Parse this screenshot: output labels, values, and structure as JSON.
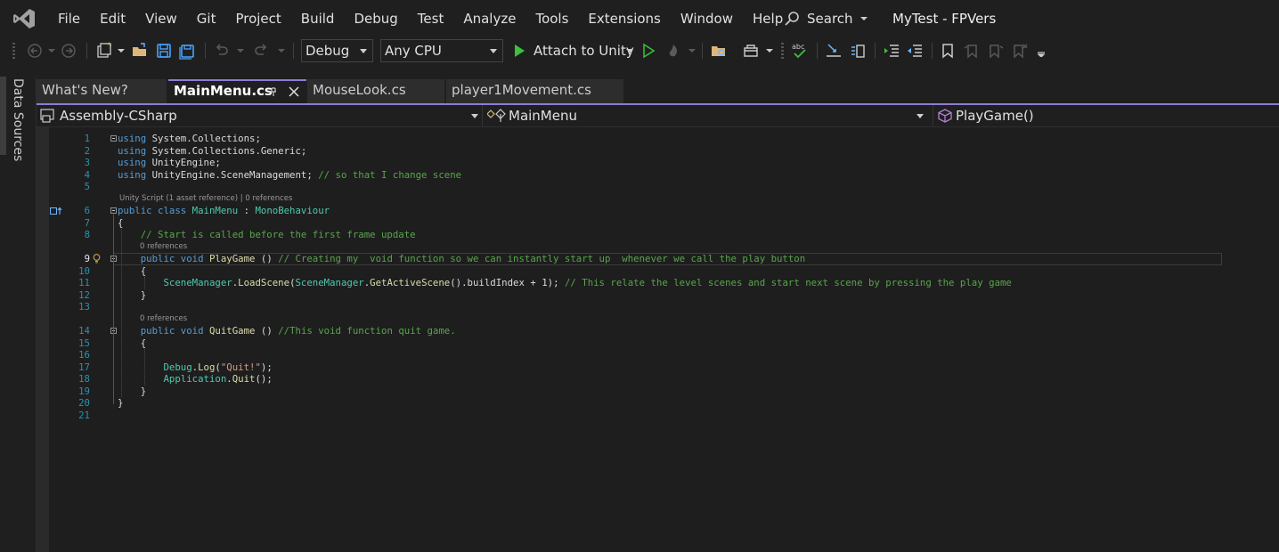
{
  "menu": [
    "File",
    "Edit",
    "View",
    "Git",
    "Project",
    "Build",
    "Debug",
    "Test",
    "Analyze",
    "Tools",
    "Extensions",
    "Window",
    "Help"
  ],
  "search_label": "Search",
  "solution_name": "MyTest - FPVers",
  "toolbar": {
    "config": "Debug",
    "platform": "Any CPU",
    "attach_label": "Attach to Unity",
    "icons": [
      "back-icon",
      "forward-icon",
      "new-item-icon",
      "open-folder-icon",
      "save-icon",
      "save-all-icon",
      "undo-icon",
      "redo-icon",
      "start-icon",
      "start-without-debugging-icon",
      "hot-reload-icon",
      "solution-explorer-icon",
      "toolbox-icon",
      "spell-check-icon",
      "step-into-icon",
      "compare-icon",
      "indent-icon",
      "outdent-icon",
      "bookmark-icon",
      "bookmark-prev-icon",
      "bookmark-next-icon",
      "bookmark-clear-icon",
      "toolbar-overflow-icon"
    ]
  },
  "side_panel_label": "Data Sources",
  "tabs": [
    {
      "label": "What's New?"
    },
    {
      "label": "MainMenu.cs"
    },
    {
      "label": "MouseLook.cs"
    },
    {
      "label": "player1Movement.cs"
    }
  ],
  "nav": {
    "project": "Assembly-CSharp",
    "class": "MainMenu",
    "member": "PlayGame()"
  },
  "code": {
    "current_line": 9,
    "lines": [
      {
        "n": "1",
        "tokens": [
          [
            "kw",
            "using"
          ],
          [
            "pl",
            " System."
          ],
          [
            "pl",
            "Collections;"
          ]
        ]
      },
      {
        "n": "2",
        "tokens": [
          [
            "kw",
            "using"
          ],
          [
            "pl",
            " System.Collections.Generic;"
          ]
        ]
      },
      {
        "n": "3",
        "tokens": [
          [
            "kw",
            "using"
          ],
          [
            "pl",
            " UnityEngine;"
          ]
        ]
      },
      {
        "n": "4",
        "tokens": [
          [
            "kw",
            "using"
          ],
          [
            "pl",
            " UnityEngine.SceneManagement; "
          ],
          [
            "cm",
            "// so that I change scene"
          ]
        ]
      },
      {
        "n": "5",
        "tokens": []
      },
      {
        "lens": "Unity Script (1 asset reference) | 0 references"
      },
      {
        "n": "6",
        "tokens": [
          [
            "kw",
            "public class "
          ],
          [
            "ty",
            "MainMenu"
          ],
          [
            "pl",
            " : "
          ],
          [
            "ty",
            "MonoBehaviour"
          ]
        ]
      },
      {
        "n": "7",
        "tokens": [
          [
            "pl",
            "{"
          ]
        ]
      },
      {
        "n": "8",
        "tokens": [
          [
            "pl",
            "    "
          ],
          [
            "cm",
            "// Start is called before the first frame update"
          ]
        ]
      },
      {
        "lens": "0 references"
      },
      {
        "n": "9",
        "tokens": [
          [
            "pl",
            "    "
          ],
          [
            "kw",
            "public void "
          ],
          [
            "fn",
            "PlayGame"
          ],
          [
            "pl",
            " () "
          ],
          [
            "cm",
            "// Creating my  void function so we can instantly start up  whenever we call the play button"
          ]
        ]
      },
      {
        "n": "10",
        "tokens": [
          [
            "pl",
            "    {"
          ]
        ]
      },
      {
        "n": "11",
        "tokens": [
          [
            "pl",
            "        "
          ],
          [
            "ty",
            "SceneManager"
          ],
          [
            "pl",
            "."
          ],
          [
            "fn",
            "LoadScene"
          ],
          [
            "pl",
            "("
          ],
          [
            "ty",
            "SceneManager"
          ],
          [
            "pl",
            "."
          ],
          [
            "fn",
            "GetActiveScene"
          ],
          [
            "pl",
            "().buildIndex + 1); "
          ],
          [
            "cm",
            "// This relate the level scenes and start next scene by pressing the play game"
          ]
        ]
      },
      {
        "n": "12",
        "tokens": [
          [
            "pl",
            "    }"
          ]
        ]
      },
      {
        "n": "13",
        "tokens": []
      },
      {
        "lens": "0 references"
      },
      {
        "n": "14",
        "tokens": [
          [
            "pl",
            "    "
          ],
          [
            "kw",
            "public void "
          ],
          [
            "fn",
            "QuitGame"
          ],
          [
            "pl",
            " () "
          ],
          [
            "cm",
            "//This void function quit game."
          ]
        ]
      },
      {
        "n": "15",
        "tokens": [
          [
            "pl",
            "    {"
          ]
        ]
      },
      {
        "n": "16",
        "tokens": []
      },
      {
        "n": "17",
        "tokens": [
          [
            "pl",
            "        "
          ],
          [
            "ty",
            "Debug"
          ],
          [
            "pl",
            "."
          ],
          [
            "fn",
            "Log"
          ],
          [
            "pl",
            "("
          ],
          [
            "st",
            "\"Quit!\""
          ],
          [
            "pl",
            ");"
          ]
        ]
      },
      {
        "n": "18",
        "tokens": [
          [
            "pl",
            "        "
          ],
          [
            "ty",
            "Application"
          ],
          [
            "pl",
            "."
          ],
          [
            "fn",
            "Quit"
          ],
          [
            "pl",
            "();"
          ]
        ]
      },
      {
        "n": "19",
        "tokens": [
          [
            "pl",
            "    }"
          ]
        ]
      },
      {
        "n": "20",
        "tokens": [
          [
            "pl",
            "}"
          ]
        ]
      },
      {
        "n": "21",
        "tokens": []
      }
    ]
  }
}
